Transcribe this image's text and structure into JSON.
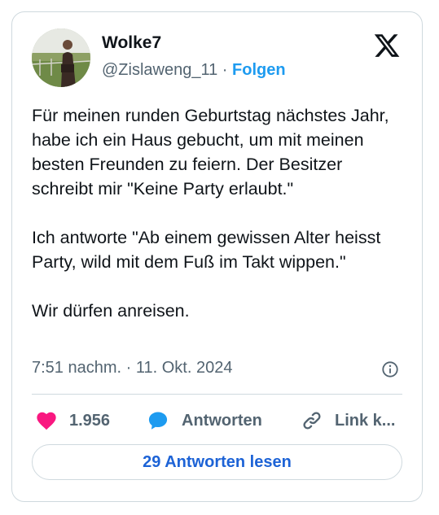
{
  "user": {
    "display_name": "Wolke7",
    "handle": "@Zislaweng_11",
    "separator": "·",
    "follow_label": "Folgen"
  },
  "tweet": {
    "text": "Für meinen runden Geburtstag nächstes Jahr, habe ich ein Haus gebucht, um mit meinen besten Freunden zu feiern. Der Besitzer schreibt mir \"Keine Party erlaubt.\"\n\nIch antworte \"Ab einem gewissen Alter heisst Party, wild mit dem Fuß im Takt wippen.\"\n\nWir dürfen anreisen.",
    "timestamp": "7:51 nachm. · 11. Okt. 2024"
  },
  "actions": {
    "likes_count": "1.956",
    "reply_label": "Antworten",
    "copy_link_label": "Link k..."
  },
  "read_replies_label": "29 Antworten lesen",
  "icons": {
    "brand": "x-logo-icon",
    "info": "info-icon",
    "like": "heart-icon",
    "reply": "speech-bubble-icon",
    "link": "link-icon"
  },
  "colors": {
    "accent": "#1d9bf0",
    "like": "#f91880",
    "secondary_text": "#536471",
    "border": "#cfd9de"
  }
}
